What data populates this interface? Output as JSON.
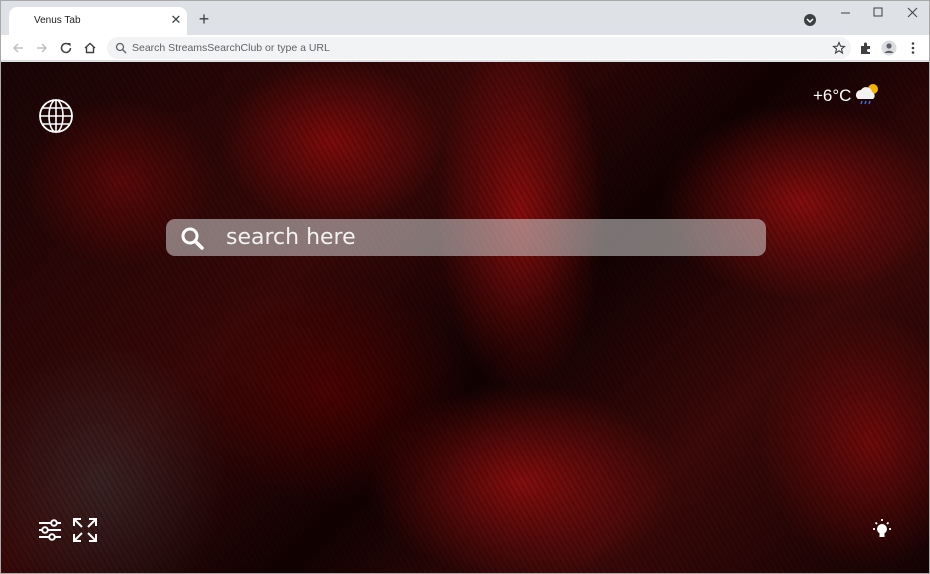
{
  "tab": {
    "title": "Venus Tab",
    "close_glyph": "✕",
    "new_tab_glyph": "+"
  },
  "window_controls": [
    "minimize",
    "maximize",
    "close"
  ],
  "omnibox": {
    "placeholder": "Search StreamsSearchClub or type a URL"
  },
  "weather": {
    "temperature": "+6°C",
    "icon": "cloud-rain-sun-icon"
  },
  "search": {
    "placeholder": "search here"
  },
  "colors": {
    "accent": "#c81414",
    "page_bg": "#1a0505",
    "search_bg": "#c8c8c8"
  }
}
